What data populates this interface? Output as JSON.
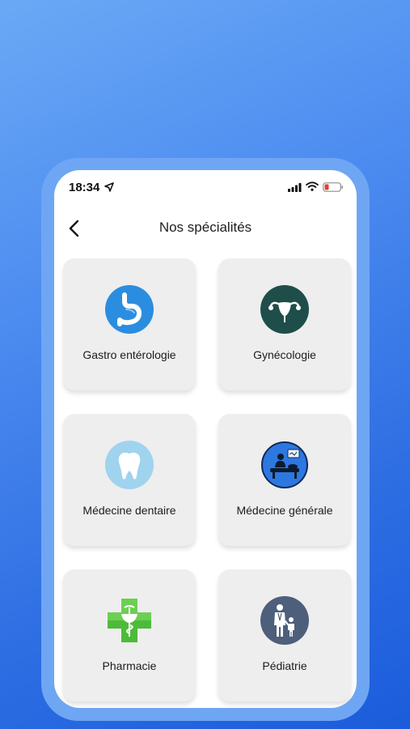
{
  "status": {
    "time": "18:34"
  },
  "header": {
    "title": "Nos spécialités"
  },
  "specialties": [
    {
      "label": "Gastro entérologie",
      "icon": "stomach-icon",
      "color": "#2b8de0"
    },
    {
      "label": "Gynécologie",
      "icon": "uterus-icon",
      "color": "#1f4e4a"
    },
    {
      "label": "Médecine dentaire",
      "icon": "tooth-icon",
      "color": "#9fd3ee"
    },
    {
      "label": "Médecine générale",
      "icon": "doctor-patient-icon",
      "color": "#2d78e0"
    },
    {
      "label": "Pharmacie",
      "icon": "pharmacy-cross-icon",
      "color": "#4dbb3a"
    },
    {
      "label": "Pédiatrie",
      "icon": "pediatrician-icon",
      "color": "#4d5f7a"
    }
  ]
}
